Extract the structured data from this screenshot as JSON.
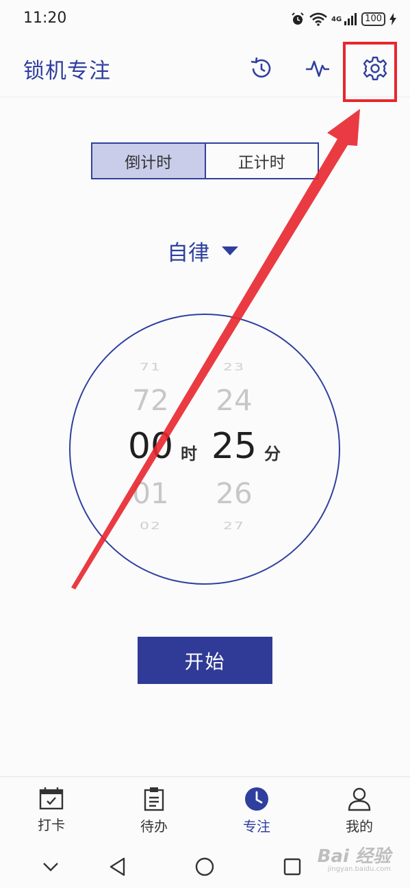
{
  "status_bar": {
    "time": "11:20",
    "net_label": "4G",
    "battery": "100"
  },
  "header": {
    "title": "锁机专注",
    "icons": [
      "history-icon",
      "pulse-icon",
      "settings-gear-icon"
    ]
  },
  "mode_toggle": {
    "countdown_label": "倒计时",
    "countup_label": "正计时",
    "selected": "倒计时"
  },
  "focus_mode": {
    "label": "自律"
  },
  "picker": {
    "hours": {
      "far_above": "71",
      "above": "72",
      "selected": "00",
      "below": "01",
      "far_below": "02"
    },
    "minutes": {
      "far_above": "23",
      "above": "24",
      "selected": "25",
      "below": "26",
      "far_below": "27"
    },
    "hour_unit": "时",
    "minute_unit": "分"
  },
  "start_button": {
    "label": "开始"
  },
  "tabs": [
    {
      "label": "打卡",
      "icon": "calendar-check-icon"
    },
    {
      "label": "待办",
      "icon": "clipboard-icon"
    },
    {
      "label": "专注",
      "icon": "clock-icon",
      "active": true
    },
    {
      "label": "我的",
      "icon": "user-icon"
    }
  ],
  "watermark": {
    "text": "Bai 经验",
    "sub": "jingyan.baidu.com"
  },
  "colors": {
    "accent": "#2f3f9e",
    "segment_active": "#cacdea",
    "annotation_red": "#e8262d"
  }
}
